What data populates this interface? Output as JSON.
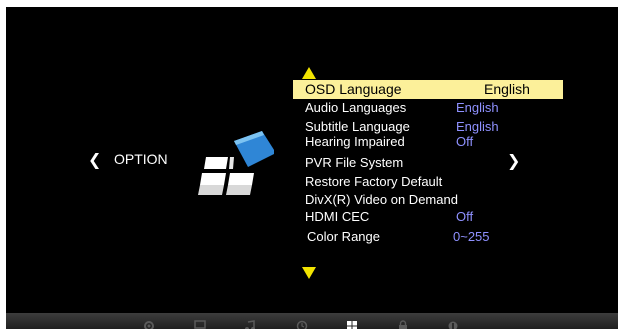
{
  "colors": {
    "background": "#000000",
    "highlight": "#fcf09a",
    "value_text": "#8f91ff",
    "label_text": "#ffffff",
    "arrow": "#f2e400"
  },
  "nav": {
    "prev_glyph": "❮",
    "next_glyph": "❯"
  },
  "category": {
    "label": "OPTION",
    "icon": "option-tiles-icon"
  },
  "menu": [
    {
      "label": "OSD Language",
      "value": "English",
      "selected": true
    },
    {
      "label": "Audio Languages",
      "value": "English"
    },
    {
      "label": "Subtitle Language",
      "value": "English"
    },
    {
      "label": "Hearing Impaired",
      "value": "Off"
    },
    {
      "label": "PVR File System",
      "value": ""
    },
    {
      "label": "Restore Factory Default",
      "value": ""
    },
    {
      "label": "DivX(R) Video on Demand",
      "value": ""
    },
    {
      "label": "HDMI CEC",
      "value": "Off"
    },
    {
      "label": "Color Range",
      "value": "0~255"
    }
  ],
  "bottom_tabs": [
    "gear-icon",
    "monitor-icon",
    "music-icon",
    "clock-icon",
    "option-grid-icon",
    "lock-icon",
    "usb-icon"
  ]
}
